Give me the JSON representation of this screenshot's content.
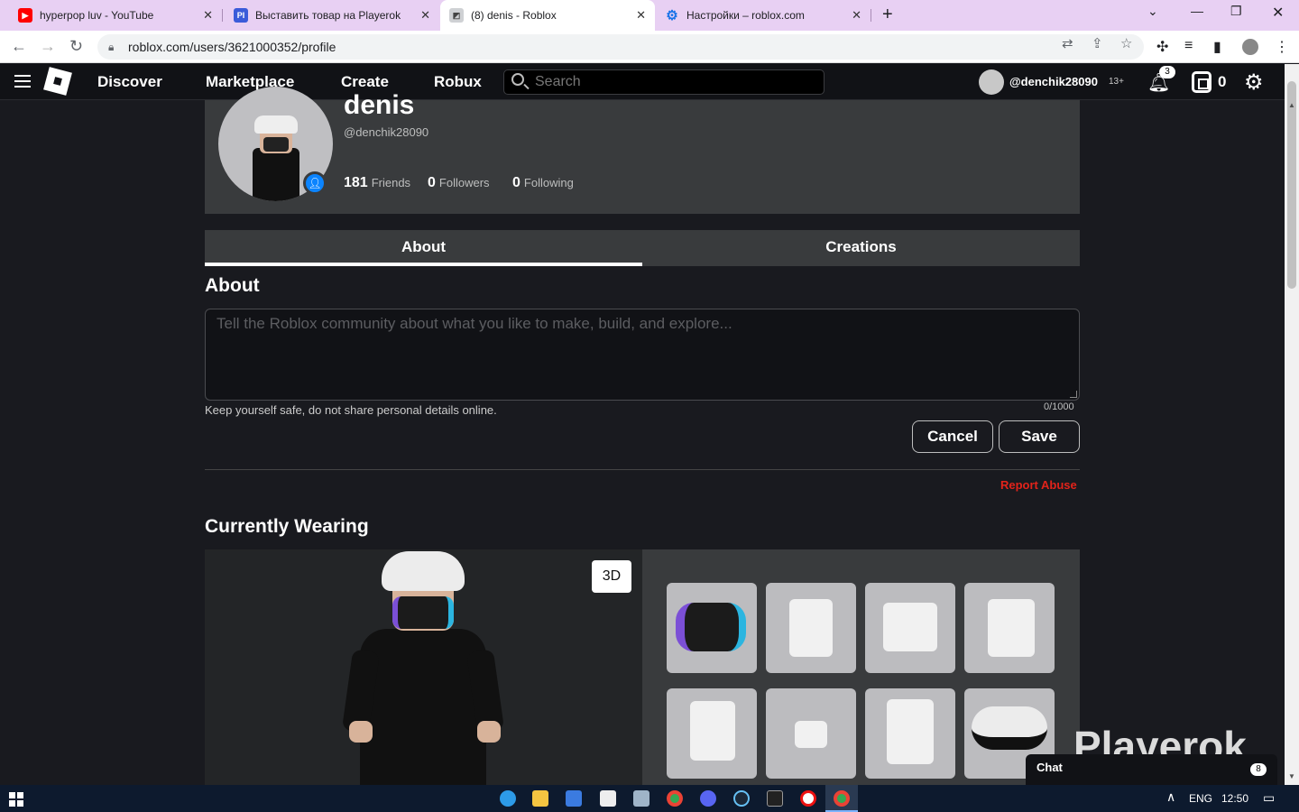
{
  "browser": {
    "tabs": [
      {
        "title": "hyperpop luv - YouTube",
        "favicon": "youtube-icon"
      },
      {
        "title": "Выставить товар на Playerok",
        "favicon": "playerok-icon",
        "favicon_text": "PI"
      },
      {
        "title": "(8) denis - Roblox",
        "favicon": "roblox-icon"
      },
      {
        "title": "Настройки – roblox.com",
        "favicon": "settings-icon"
      }
    ],
    "url": "roblox.com/users/3621000352/profile"
  },
  "nav": {
    "links": [
      "Discover",
      "Marketplace",
      "Create",
      "Robux"
    ],
    "search_placeholder": "Search",
    "username": "@denchik28090",
    "age_badge": "13+",
    "notifications": "3",
    "robux": "0"
  },
  "profile": {
    "display_name": "denis",
    "handle": "@denchik28090",
    "friends_count": "181",
    "friends_label": "Friends",
    "followers_count": "0",
    "followers_label": "Followers",
    "following_count": "0",
    "following_label": "Following"
  },
  "tabs": {
    "about": "About",
    "creations": "Creations"
  },
  "about": {
    "heading": "About",
    "placeholder": "Tell the Roblox community about what you like to make, build, and explore...",
    "hint": "Keep yourself safe, do not share personal details online.",
    "counter": "0/1000",
    "cancel": "Cancel",
    "save": "Save",
    "report": "Report Abuse"
  },
  "wearing": {
    "heading": "Currently Wearing",
    "toggle_3d": "3D"
  },
  "overlay": {
    "watermark": "Playerok",
    "chat_label": "Chat",
    "chat_badge": "8"
  },
  "taskbar": {
    "lang": "ENG",
    "time": "12:50"
  },
  "colors": {
    "tab_strip": "#e8d0f3",
    "page_bg": "#191a1f",
    "panel": "#393b3d",
    "report": "#e2231a",
    "verified": "#0b84ff"
  }
}
